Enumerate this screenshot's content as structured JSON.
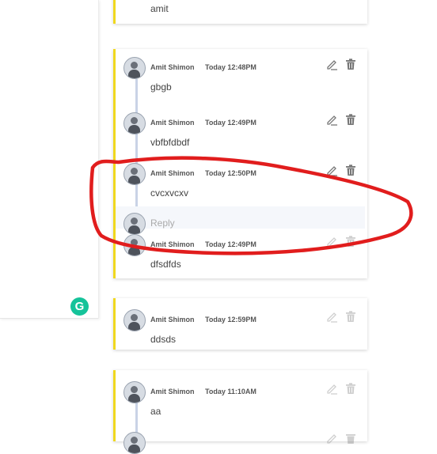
{
  "cards": [
    {
      "comments": [
        {
          "text": "amit"
        }
      ]
    },
    {
      "comments": [
        {
          "author": "Amit Shimon",
          "time": "Today 12:48PM",
          "text": "gbgb"
        },
        {
          "author": "Amit Shimon",
          "time": "Today 12:49PM",
          "text": "vbfbfdbdf"
        },
        {
          "author": "Amit Shimon",
          "time": "Today 12:50PM",
          "text": "cvcxvcxv"
        },
        {
          "author": "Amit Shimon",
          "time": "Today 12:49PM",
          "text": "dfsdfds"
        }
      ],
      "reply_placeholder": "Reply"
    },
    {
      "comments": [
        {
          "author": "Amit Shimon",
          "time": "Today 12:59PM",
          "text": "ddsds"
        }
      ]
    },
    {
      "comments": [
        {
          "author": "Amit Shimon",
          "time": "Today 11:10AM",
          "text": "aa"
        }
      ]
    }
  ],
  "grammarly": {
    "label": "G"
  },
  "icons": {
    "edit": "pencil-icon",
    "delete": "trash-icon",
    "annotation": "red-ellipse-annotation"
  },
  "colors": {
    "card_accent": "#f0d81e",
    "thread_line": "#c9d3e6",
    "annotation": "#e11d1d"
  }
}
